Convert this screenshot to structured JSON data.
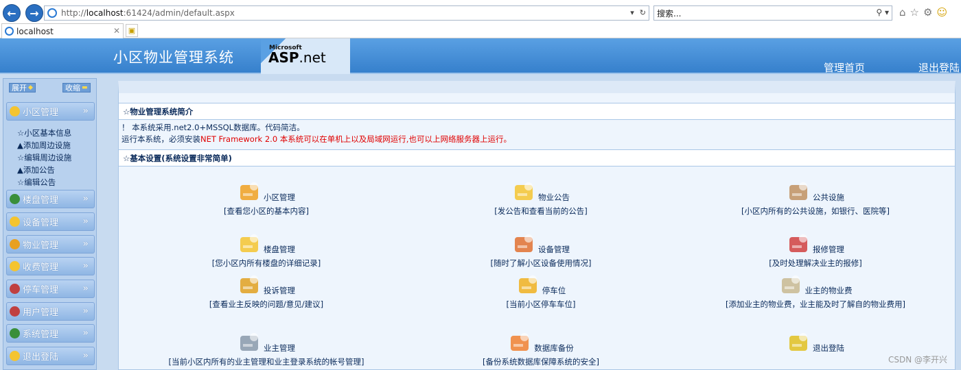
{
  "browser": {
    "url_prefix": "http://",
    "url_host": "localhost",
    "url_rest": ":61424/admin/default.aspx",
    "search_placeholder": "搜索...",
    "tab_title": "localhost"
  },
  "header": {
    "title": "小区物业管理系统",
    "logo_microsoft": "Microsoft",
    "logo_asp": "ASP",
    "logo_net": ".net",
    "home_link": "管理首页",
    "logout_link": "退出登陆"
  },
  "sidebar": {
    "expand_label": "展开",
    "collapse_label": "收缩",
    "menus": [
      {
        "label": "小区管理",
        "color": "#f4c430"
      },
      {
        "label": "楼盘管理",
        "color": "#3a8f3a"
      },
      {
        "label": "设备管理",
        "color": "#f4c430"
      },
      {
        "label": "物业管理",
        "color": "#e8a020"
      },
      {
        "label": "收费管理",
        "color": "#f4c430"
      },
      {
        "label": "停车管理",
        "color": "#c04040"
      },
      {
        "label": "用户管理",
        "color": "#c04040"
      },
      {
        "label": "系统管理",
        "color": "#3a8f3a"
      },
      {
        "label": "退出登陆",
        "color": "#f4c430"
      }
    ],
    "submenu": [
      "☆小区基本信息",
      "▲添加周边设施",
      "☆编辑周边设施",
      "▲添加公告",
      "☆编辑公告"
    ]
  },
  "main": {
    "intro_title": "☆物业管理系统简介",
    "intro_line1": "！ 本系统采用.net2.0+MSSQL数据库。代码简洁。",
    "intro_line2_prefix": "运行本系统，必须安装",
    "intro_line2_red": "NET Framework 2.0 本系统可以在单机上以及局域网运行,也可以上网络服务器上运行。",
    "settings_title": "☆基本设置(系统设置非常简单)",
    "items": [
      {
        "label": "小区管理",
        "desc": "[查看您小区的基本内容]"
      },
      {
        "label": "物业公告",
        "desc": "[发公告和查看当前的公告]"
      },
      {
        "label": "公共设施",
        "desc": "[小区内所有的公共设施，如银行、医院等]"
      },
      {
        "label": "楼盘管理",
        "desc": "[您小区内所有楼盘的详细记录]"
      },
      {
        "label": "设备管理",
        "desc": "[随时了解小区设备使用情况]"
      },
      {
        "label": "报修管理",
        "desc": "[及时处理解决业主的报修]"
      },
      {
        "label": "投诉管理",
        "desc": "[查看业主反映的问题/意见/建议]"
      },
      {
        "label": "停车位",
        "desc": "[当前小区停车车位]"
      },
      {
        "label": "业主的物业费",
        "desc": "[添加业主的物业费，业主能及时了解自的物业费用]"
      },
      {
        "label": "业主管理",
        "desc": "[当前小区内所有的业主管理和业主登录系统的帐号管理]"
      },
      {
        "label": "数据库备份",
        "desc": "[备份系统数据库保障系统的安全]"
      },
      {
        "label": "退出登陆",
        "desc": ""
      }
    ]
  },
  "watermark": "CSDN @李开兴"
}
